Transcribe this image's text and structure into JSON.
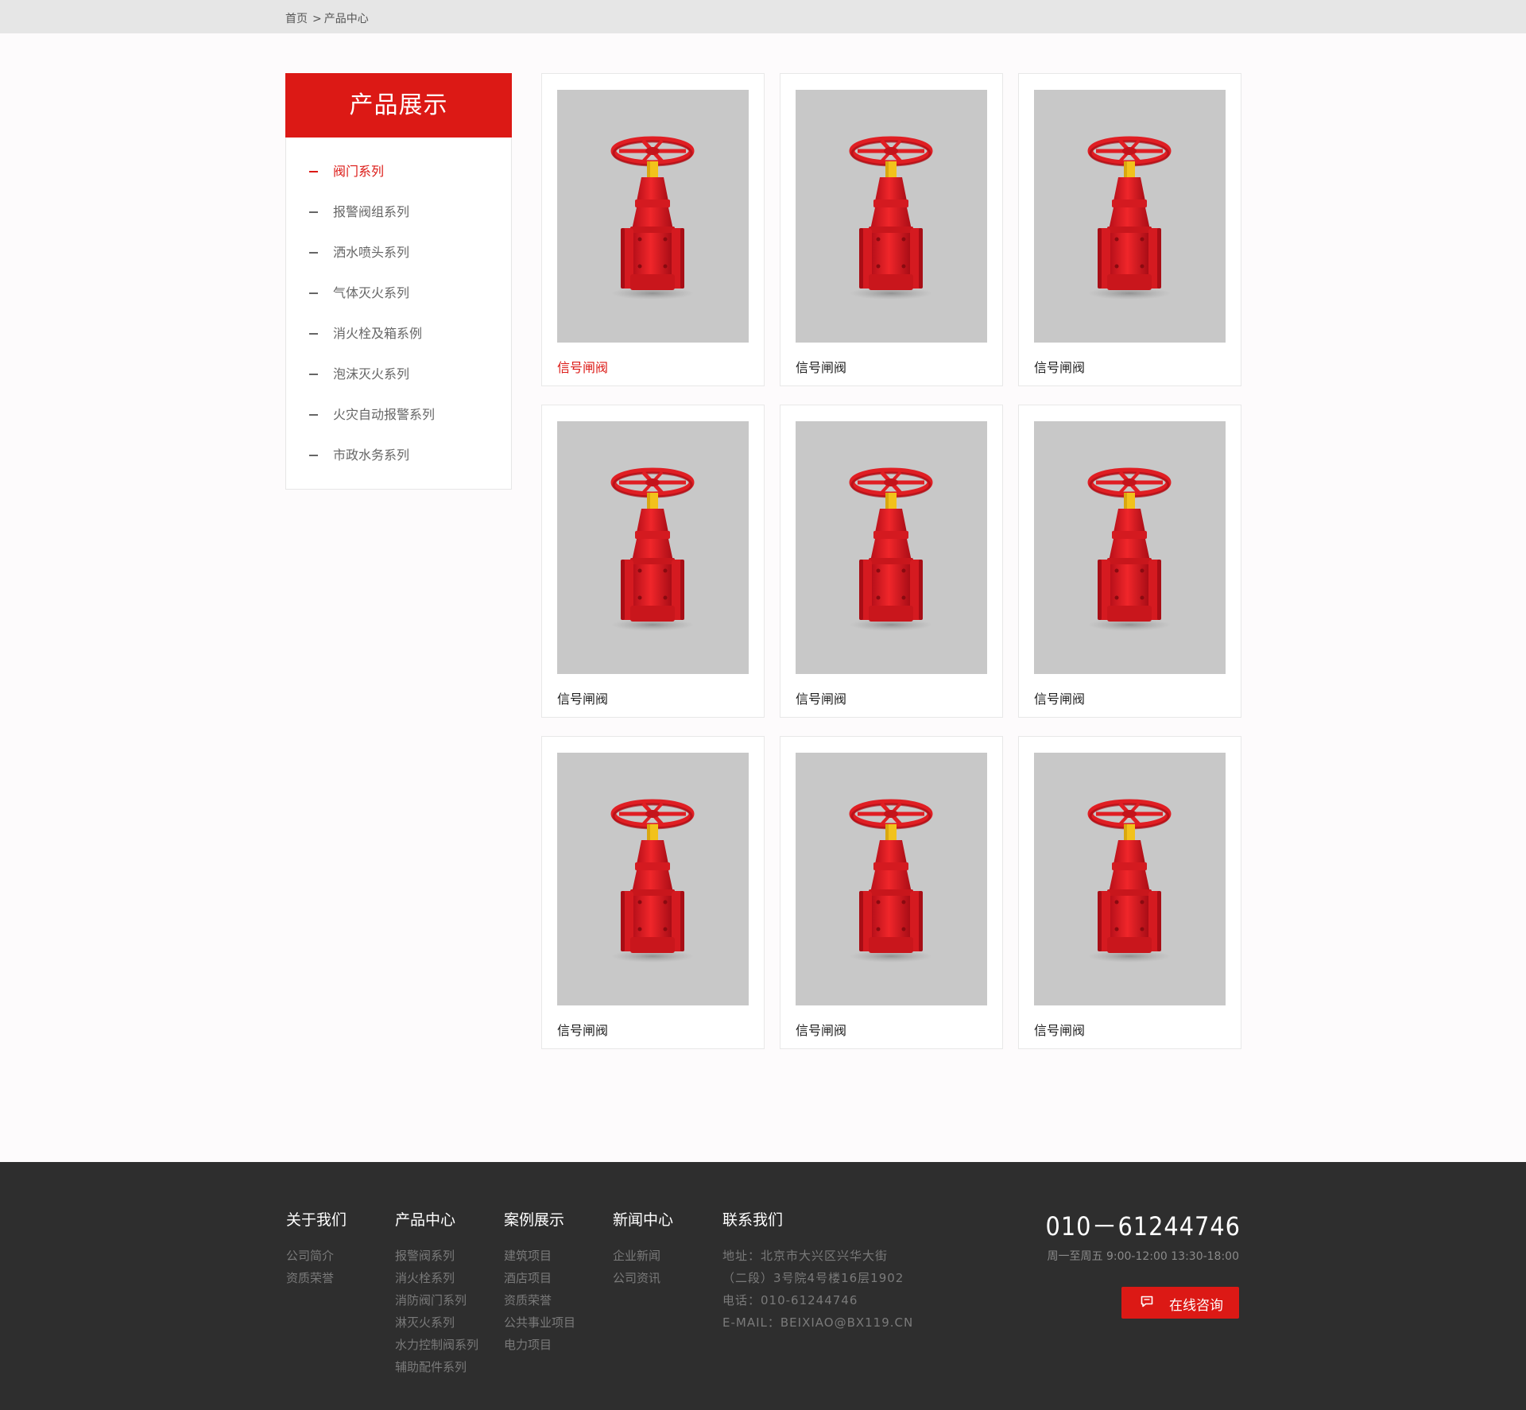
{
  "breadcrumb": {
    "home": "首页",
    "separator": ">",
    "current": "产品中心"
  },
  "sidebar": {
    "title": "产品展示",
    "items": [
      {
        "label": "阀门系列",
        "active": true
      },
      {
        "label": "报警阀组系列",
        "active": false
      },
      {
        "label": "洒水喷头系列",
        "active": false
      },
      {
        "label": "气体灭火系列",
        "active": false
      },
      {
        "label": "消火栓及箱系例",
        "active": false
      },
      {
        "label": "泡沫灭火系列",
        "active": false
      },
      {
        "label": "火灾自动报警系列",
        "active": false
      },
      {
        "label": "市政水务系列",
        "active": false
      }
    ]
  },
  "products": [
    {
      "name": "信号闸阀",
      "active": true
    },
    {
      "name": "信号闸阀",
      "active": false
    },
    {
      "name": "信号闸阀",
      "active": false
    },
    {
      "name": "信号闸阀",
      "active": false
    },
    {
      "name": "信号闸阀",
      "active": false
    },
    {
      "name": "信号闸阀",
      "active": false
    },
    {
      "name": "信号闸阀",
      "active": false
    },
    {
      "name": "信号闸阀",
      "active": false
    },
    {
      "name": "信号闸阀",
      "active": false
    }
  ],
  "footer": {
    "about": {
      "title": "关于我们",
      "links": [
        "公司简介",
        "资质荣誉"
      ]
    },
    "products": {
      "title": "产品中心",
      "links": [
        "报警阀系列",
        "消火栓系列",
        "消防阀门系列",
        "淋灭火系列",
        "水力控制阀系列",
        "辅助配件系列"
      ]
    },
    "cases": {
      "title": "案例展示",
      "links": [
        "建筑项目",
        "酒店项目",
        "资质荣誉",
        "公共事业项目",
        "电力项目"
      ]
    },
    "news": {
      "title": "新闻中心",
      "links": [
        "企业新闻",
        "公司资讯"
      ]
    },
    "contact": {
      "title": "联系我们",
      "lines": [
        "地址：北京市大兴区兴华大街",
        "（二段）3号院4号楼16层1902",
        "电话：010-61244746",
        "E-MAIL：BEIXIAO@BX119.CN"
      ]
    },
    "phone": "010－61244746",
    "hours": "周一至周五 9:00-12:00 13:30-18:00",
    "consult_label": "在线咨询"
  },
  "colors": {
    "brand": "#dc1915",
    "footer_bg": "#2e2e2e",
    "topbar_bg": "#e6e6e6"
  },
  "icons": {
    "consult": "chat-bubble-icon",
    "product_image": "gate-valve-image"
  }
}
